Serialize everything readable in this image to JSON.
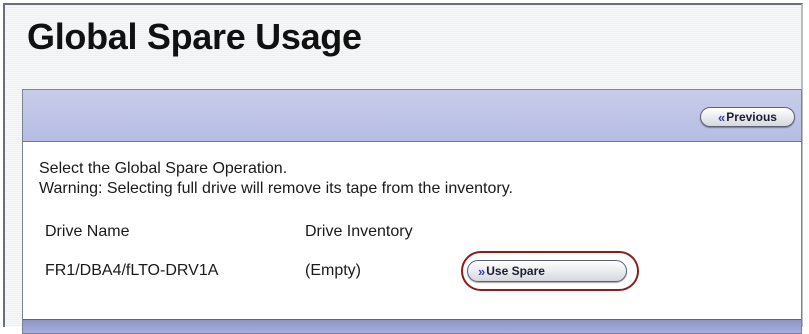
{
  "page": {
    "title": "Global Spare Usage"
  },
  "header": {
    "previous_label": "Previous",
    "previous_icon": "double-chevron-left-icon"
  },
  "instructions": {
    "line1": "Select the Global Spare Operation.",
    "line2": "Warning: Selecting full drive will remove its tape from the inventory."
  },
  "table": {
    "columns": [
      "Drive Name",
      "Drive Inventory"
    ],
    "rows": [
      {
        "drive_name": "FR1/DBA4/fLTO-DRV1A",
        "drive_inventory": "(Empty)",
        "action_label": "Use Spare",
        "action_icon": "double-chevron-right-icon"
      }
    ]
  },
  "colors": {
    "panel_header": "#b6bde4",
    "panel_footer": "#8e95c4",
    "highlight_ring": "#8a1d1d",
    "chevron": "#3a3fa8"
  }
}
